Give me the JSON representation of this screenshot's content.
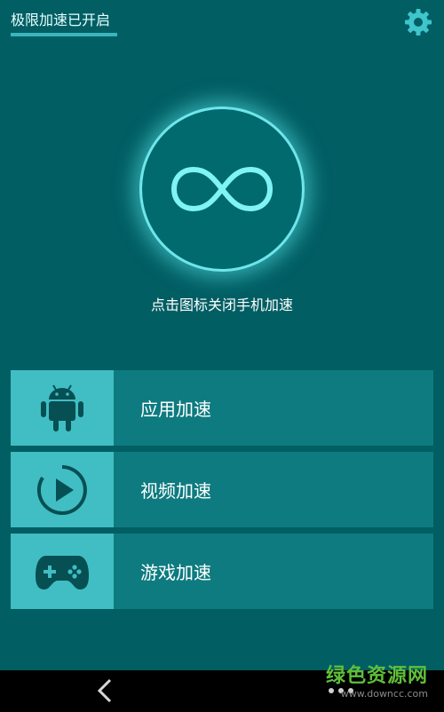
{
  "status": {
    "title": "极限加速已开启"
  },
  "main": {
    "hint": "点击图标关闭手机加速"
  },
  "features": [
    {
      "label": "应用加速",
      "icon": "android-icon"
    },
    {
      "label": "视频加速",
      "icon": "play-circle-icon"
    },
    {
      "label": "游戏加速",
      "icon": "gamepad-icon"
    }
  ],
  "watermark": {
    "main": "绿色资源网",
    "sub": "www.downcc.com"
  },
  "colors": {
    "background": "#015e63",
    "accent": "#40bec3",
    "row": "#0e7b80",
    "glow": "#6ee6ea"
  }
}
